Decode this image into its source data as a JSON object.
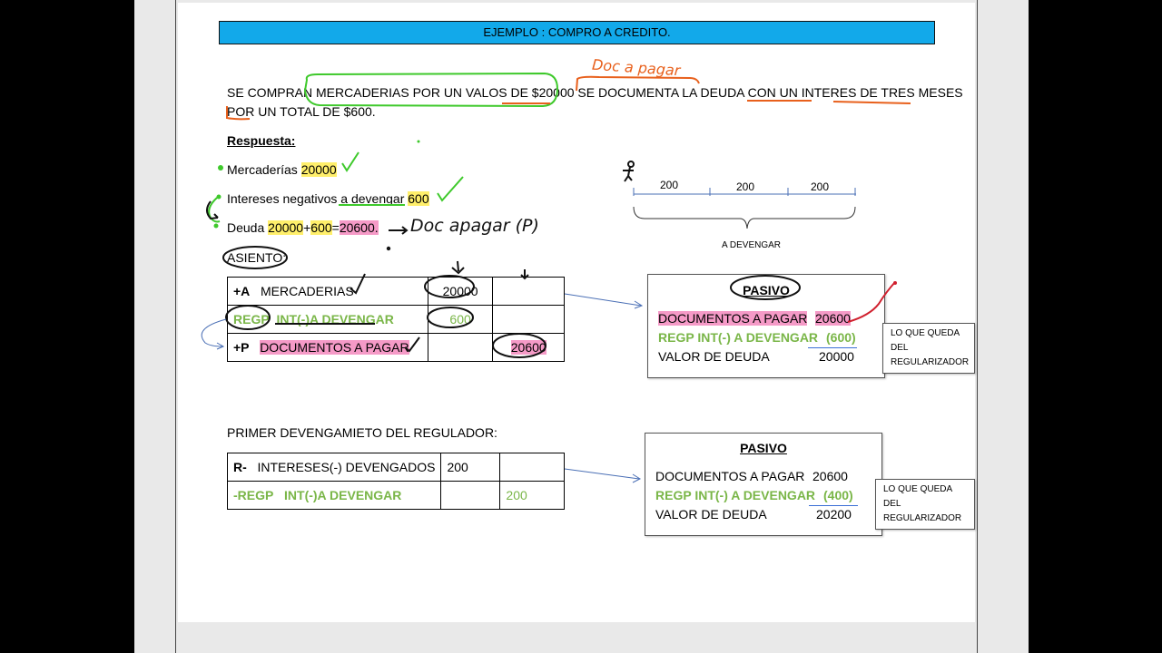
{
  "banner": "EJEMPLO : COMPRO A CREDITO.",
  "statement": {
    "line1": "SE COMPRAN MERCADERIAS POR UN VALOS DE $20000  SE DOCUMENTA LA DEUDA CON UN INTERES DE TRES MESES",
    "line2": "POR UN TOTAL DE $600."
  },
  "respuesta_label": "Respuesta:",
  "answers": {
    "merc_label": "Mercaderías ",
    "merc_value": "20000",
    "int_label": "Intereses negativos a devengar ",
    "int_value": "600",
    "deuda_label": "Deuda ",
    "deuda_a": "20000",
    "deuda_plus": "+",
    "deuda_b": "600",
    "deuda_eq": "=",
    "deuda_total": "20600."
  },
  "asiento_label": "ASIENTO:",
  "asiento_table": {
    "rows": [
      {
        "prefix": "+A",
        "account": "MERCADERIAS",
        "debe": "20000",
        "haber": ""
      },
      {
        "prefix": "REGP",
        "account": "INT(-)A DEVENGAR",
        "debe": "600",
        "haber": ""
      },
      {
        "prefix": "+P",
        "account": "DOCUMENTOS A PAGAR",
        "debe": "",
        "haber": "20600"
      }
    ]
  },
  "timeline": {
    "segments": [
      "200",
      "200",
      "200"
    ],
    "brace_label": "A DEVENGAR"
  },
  "pasivo1": {
    "title": "PASIVO",
    "doc_label": "DOCUMENTOS A PAGAR",
    "doc_value": "20600",
    "regp_label": "REGP INT(-) A DEVENGAR",
    "regp_value": "(600)",
    "valor_label": "VALOR DE DEUDA",
    "valor_value": "20000"
  },
  "note1": {
    "line1": "LO QUE QUEDA DEL",
    "line2": "REGULARIZADOR"
  },
  "primer_label": "PRIMER DEVENGAMIETO DEL REGULADOR:",
  "devengo_table": {
    "rows": [
      {
        "prefix": "R-",
        "account": "INTERESES(-) DEVENGADOS",
        "debe": "200",
        "haber": ""
      },
      {
        "prefix": "-REGP",
        "account": "INT(-)A DEVENGAR",
        "debe": "",
        "haber": "200"
      }
    ]
  },
  "pasivo2": {
    "title": "PASIVO",
    "doc_label": "DOCUMENTOS A PAGAR",
    "doc_value": "20600",
    "regp_label": "REGP INT(-) A DEVENGAR",
    "regp_value": "(400)",
    "valor_label": "VALOR DE DEUDA",
    "valor_value": "20200"
  },
  "note2": {
    "line1": "LO QUE QUEDA DEL",
    "line2": "REGULARIZADOR"
  },
  "handwriting": {
    "doc_a_pagar": "Doc a pagar",
    "doc_apagar_p": "Doc apagar (P)"
  },
  "colors": {
    "banner": "#12a9ea",
    "highlight_yellow": "#ffef6b",
    "highlight_pink": "#f59ac7",
    "green_text": "#7ab648",
    "ink_green": "#3ec92b",
    "ink_orange": "#e8601c",
    "ink_black": "#111111",
    "ink_red": "#d0202e"
  }
}
